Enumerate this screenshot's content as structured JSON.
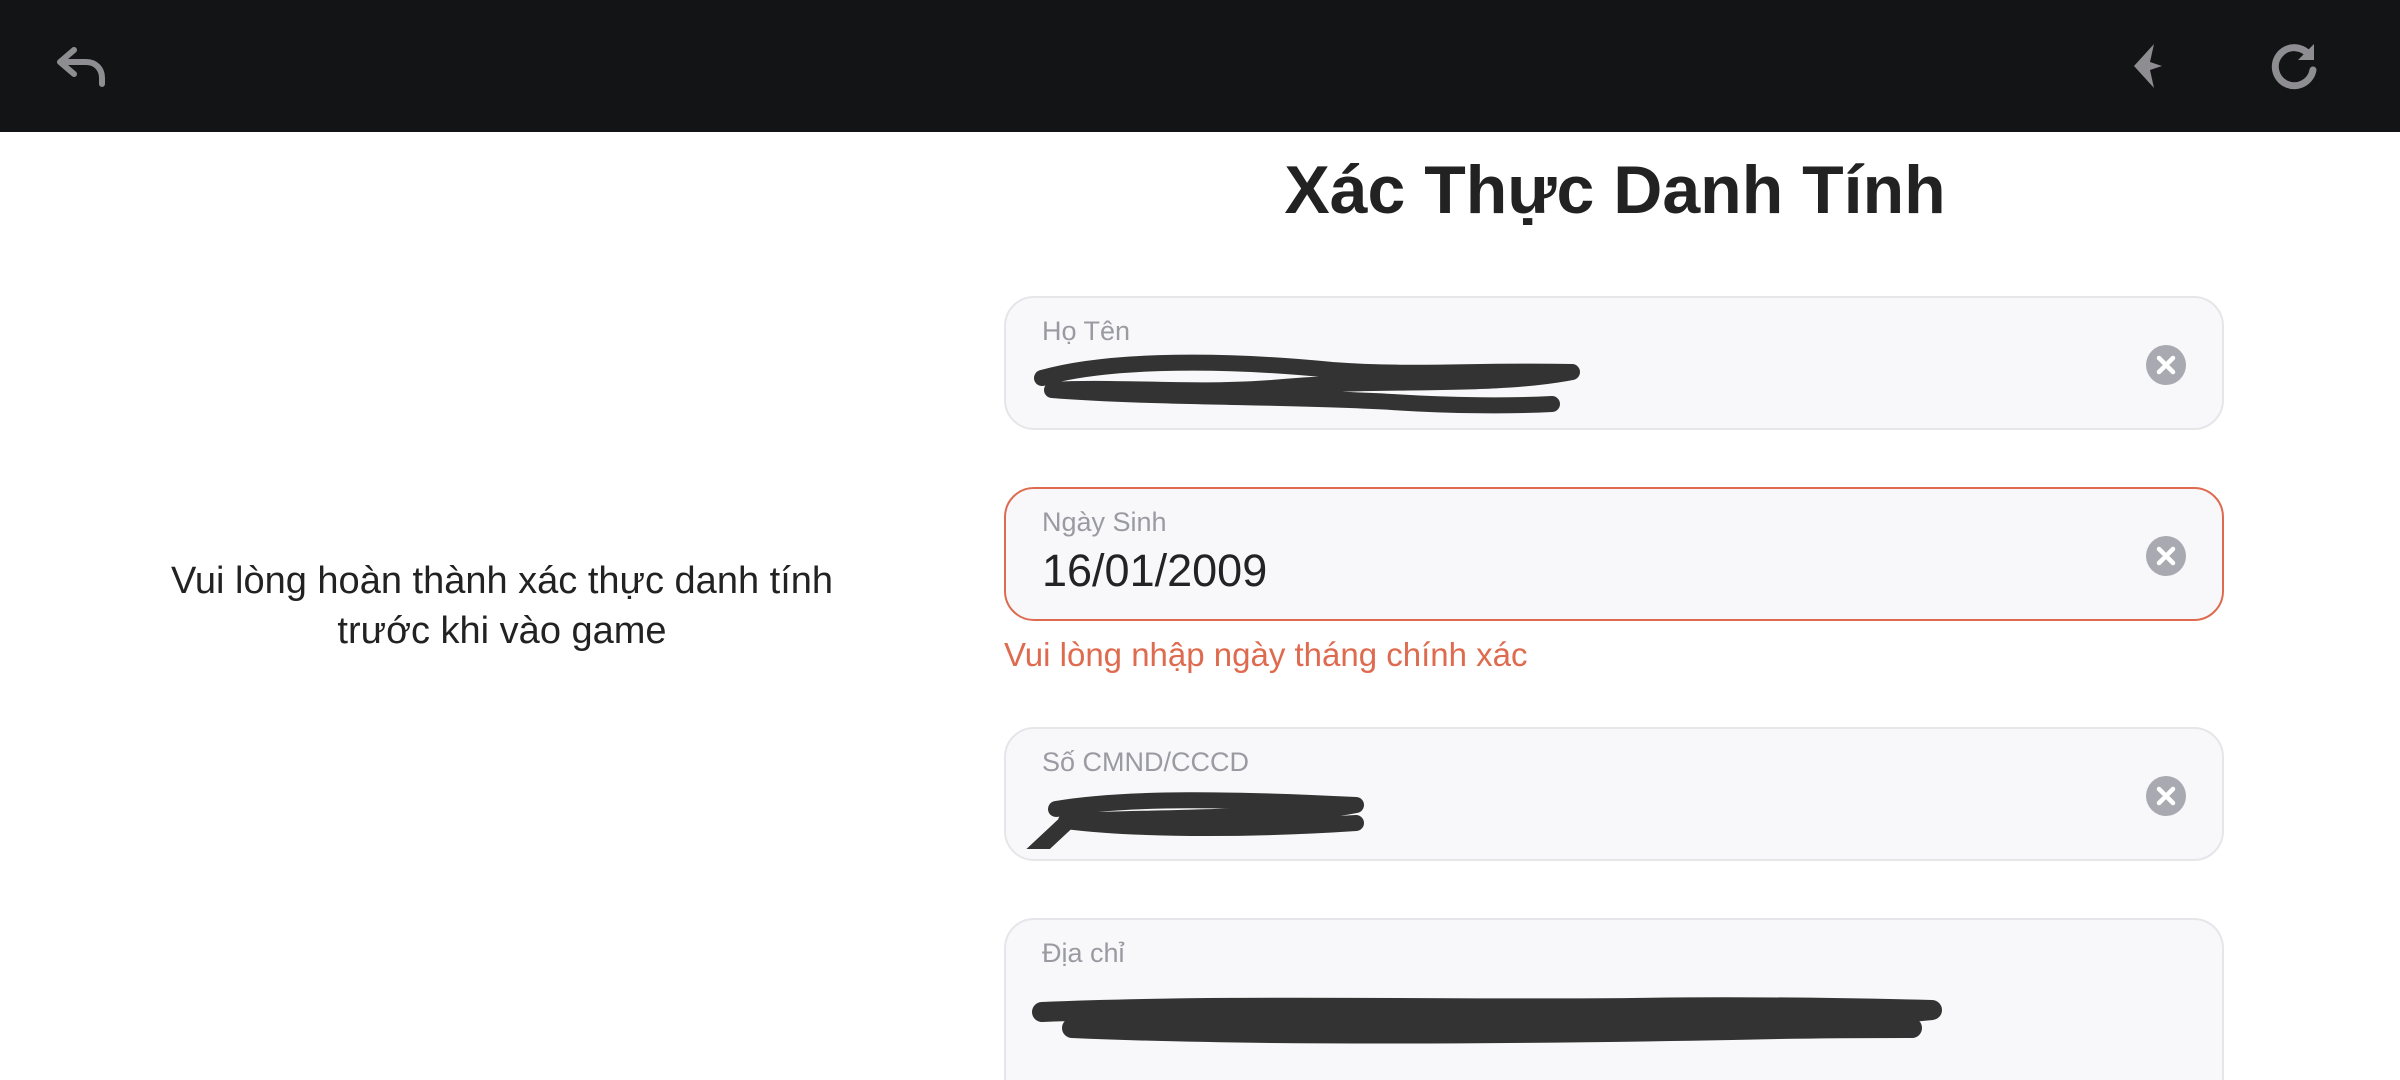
{
  "topbar": {
    "back_icon": "undo-arrow-icon",
    "assist_icon": "sparkle-arrow-icon",
    "refresh_icon": "refresh-icon",
    "background": "#131416"
  },
  "page": {
    "title": "Xác Thực Danh Tính",
    "side_message": "Vui lòng hoàn thành xác thực danh tính trước khi vào game"
  },
  "form": {
    "name": {
      "label": "Họ Tên",
      "value": "",
      "redacted": true
    },
    "dob": {
      "label": "Ngày Sinh",
      "value": "16/01/2009",
      "error": "Vui lòng nhập ngày tháng chính xác"
    },
    "id_number": {
      "label": "Số CMND/CCCD",
      "value": "",
      "redacted": true
    },
    "address": {
      "label": "Địa chỉ",
      "value": "",
      "redacted": true
    }
  },
  "colors": {
    "error": "#de6b4f",
    "field_bg": "#f8f8fa",
    "clear_icon": "#a9a9b1"
  }
}
